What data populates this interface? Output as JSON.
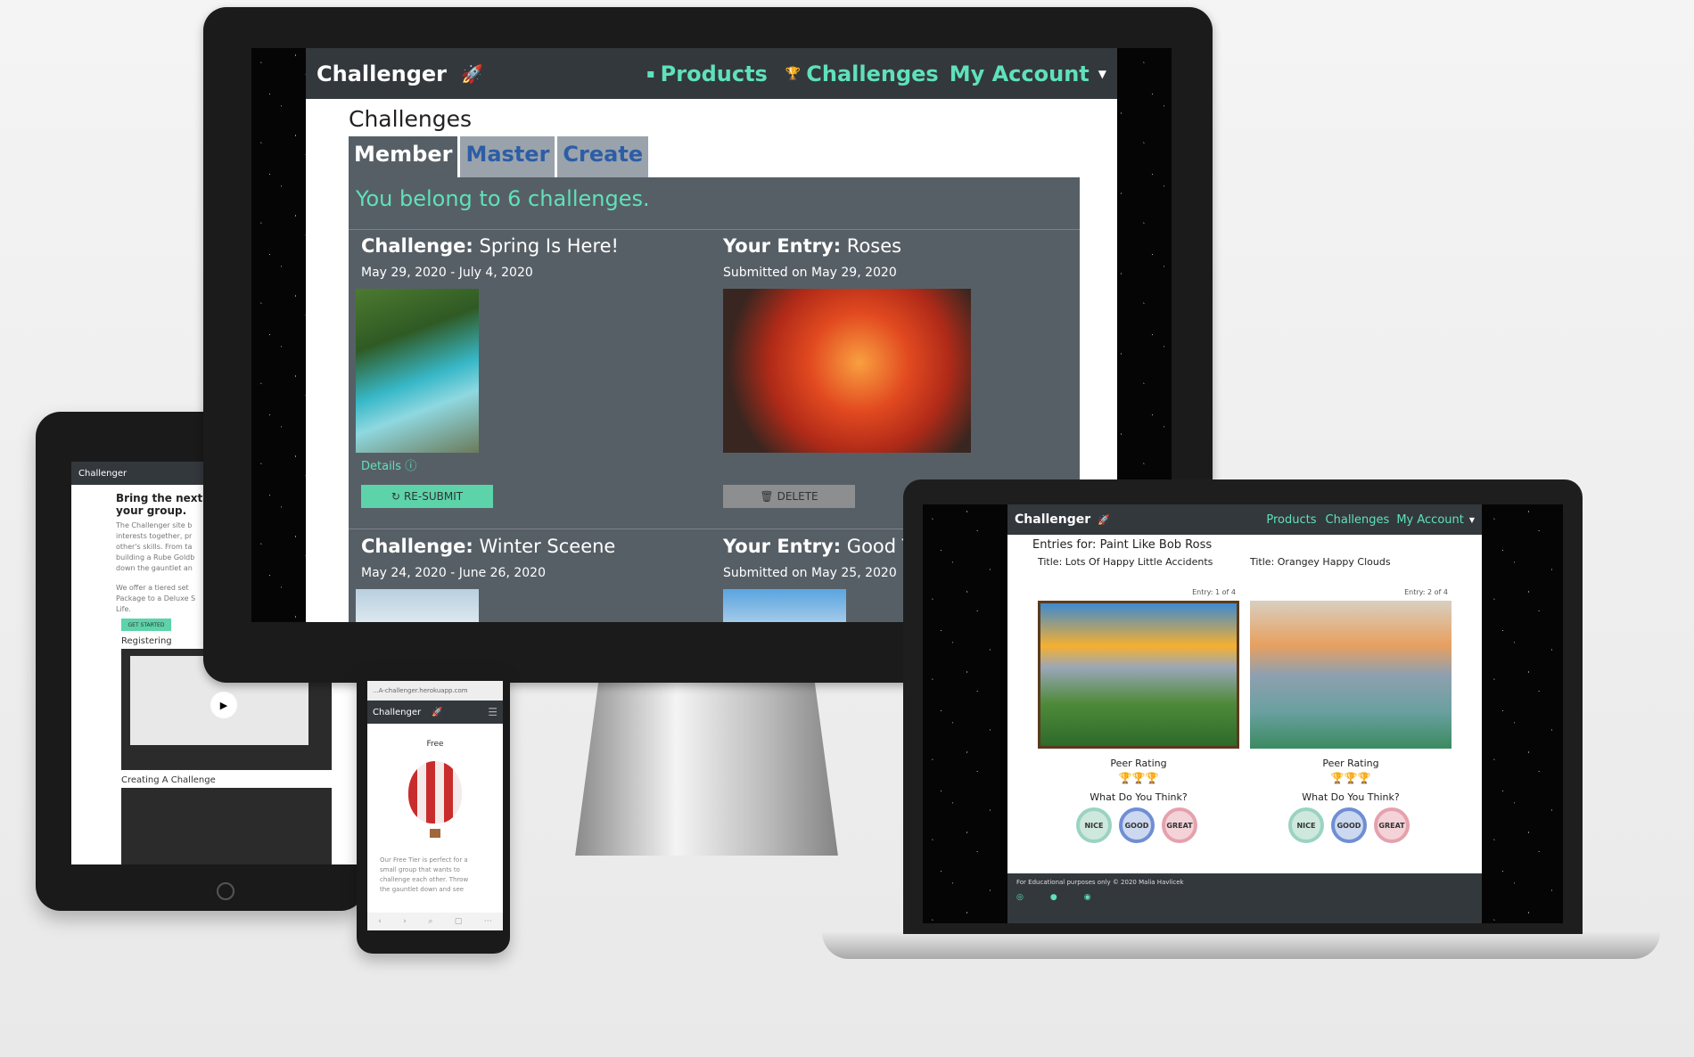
{
  "desktop": {
    "brand": "Challenger",
    "nav": {
      "products": "Products",
      "challenges": "Challenges",
      "account": "My Account"
    },
    "page_title": "Challenges",
    "tabs": {
      "member": "Member",
      "master": "Master",
      "create": "Create"
    },
    "summary": "You belong to 6 challenges.",
    "labels": {
      "challenge": "Challenge:",
      "entry": "Your Entry:",
      "details": "Details",
      "resubmit": "RE-SUBMIT",
      "delete": "DELETE"
    },
    "rows": [
      {
        "challenge": "Spring Is Here!",
        "dates": "May 29, 2020 - July 4, 2020",
        "entry": "Roses",
        "submitted": "Submitted on May 29, 2020"
      },
      {
        "challenge": "Winter Sceene",
        "dates": "May 24, 2020 - June 26, 2020",
        "entry": "Good T",
        "submitted": "Submitted on May 25, 2020"
      }
    ]
  },
  "tablet": {
    "brand": "Challenger",
    "heading": "Bring the next\nyour group.",
    "para1": "The Challenger site b\ninterests together, pr\nother's skills. From ta\nbuilding a Rube Goldb\ndown the gauntlet an",
    "para2": "We offer a tiered set\nPackage to a Deluxe S\nLife.",
    "get_started": "GET STARTED",
    "registering": "Registering",
    "creating": "Creating A Challenge"
  },
  "phone": {
    "url": "...A-challenger.herokuapp.com",
    "brand": "Challenger",
    "tier": "Free",
    "text": "Our Free Tier is perfect for a\nsmall group that wants to\nchallenge each other. Throw\nthe gauntlet down and see"
  },
  "laptop": {
    "brand": "Challenger",
    "nav": {
      "products": "Products",
      "challenges": "Challenges",
      "account": "My Account"
    },
    "entries_for": "Entries for: Paint Like Bob Ross",
    "peer_rating": "Peer Rating",
    "what_think": "What Do You Think?",
    "coins": [
      "NICE",
      "GOOD",
      "GREAT"
    ],
    "entries": [
      {
        "title": "Title: Lots Of Happy Little Accidents",
        "counter": "Entry: 1 of 4",
        "trophies": "🏆🏆🏆"
      },
      {
        "title": "Title: Orangey Happy Clouds",
        "counter": "Entry: 2 of 4",
        "trophies": "🏆🏆🏆"
      }
    ],
    "footer": "For Educational purposes only © 2020 Malia Havlicek"
  }
}
